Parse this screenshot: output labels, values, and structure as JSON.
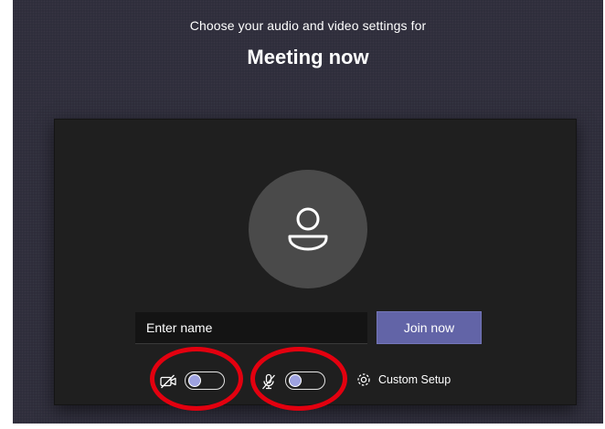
{
  "header": {
    "subtitle": "Choose your audio and video settings for",
    "title": "Meeting now"
  },
  "name_input": {
    "placeholder": "Enter name",
    "value": ""
  },
  "join_button": {
    "label": "Join now"
  },
  "controls": {
    "camera": {
      "icon": "camera-off-icon",
      "state": "off"
    },
    "microphone": {
      "icon": "microphone-off-icon",
      "state": "off"
    },
    "custom_setup": {
      "icon": "gear-icon",
      "label": "Custom Setup"
    }
  },
  "colors": {
    "background": "#2d2c3a",
    "panel": "#1f1f1f",
    "avatar": "#4a4a4a",
    "join_button": "#6264a7",
    "toggle_knob": "#9ea2e0",
    "highlight": "#e3000f"
  }
}
